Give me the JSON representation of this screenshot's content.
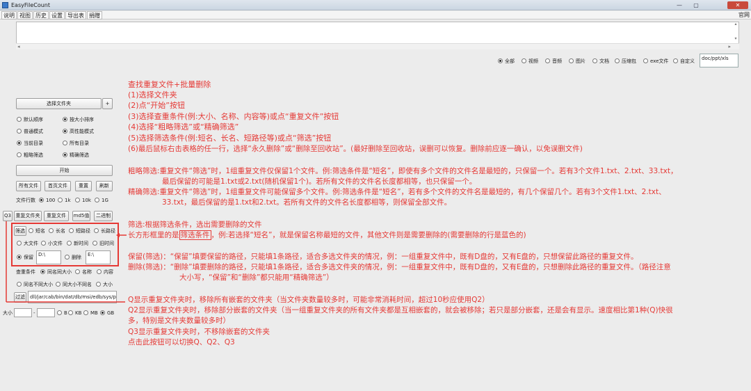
{
  "window": {
    "title": "EasyFileCount",
    "min": "—",
    "max": "▢",
    "close": "✕"
  },
  "menu": {
    "items": [
      "说明",
      "视图",
      "历史",
      "设置",
      "导出表",
      "捐赠"
    ],
    "right": "官网"
  },
  "file_types": {
    "options": [
      "全部",
      "视频",
      "音频",
      "图片",
      "文档",
      "压缩包",
      "exe文件",
      "自定义"
    ],
    "selected": "全部",
    "custom_value": "doc/ppt/xls"
  },
  "left": {
    "select_folder": "选择文件夹",
    "plus": "+",
    "sort_default": "默认顺序",
    "sort_size": "按大小排序",
    "mode_normal": "普通模式",
    "mode_high": "高性能模式",
    "dir_current": "当前目录",
    "dir_all": "所有目录",
    "filter_rough": "粗略筛选",
    "filter_precise": "精确筛选",
    "start": "开始",
    "btn_all_files": "所有文件",
    "btn_first_page": "首页文件",
    "btn_reset": "重置",
    "btn_refresh": "刷新",
    "rows_label": "文件行数",
    "rows_options": [
      "100",
      "1k",
      "10k",
      "1G"
    ],
    "rows_selected": "100",
    "q3": "Q3",
    "dup_folder": "重复文件夹",
    "dup_file": "重复文件",
    "md5": "md5值",
    "binary": "二进制",
    "filter_btn": "筛选",
    "f_short_name": "短名",
    "f_long_name": "长名",
    "f_short_path": "短路径",
    "f_long_path": "长路径",
    "f_big": "大文件",
    "f_small": "小文件",
    "f_new": "新时间",
    "f_old": "旧时间",
    "keep": "保留",
    "keep_value": "D:\\",
    "delete": "删除",
    "delete_value": "E:\\",
    "cond_label": "查重条件",
    "cond_name_size": "同名同大小",
    "cond_name": "名称",
    "cond_content": "内容",
    "cond_diffname": "同名不同大小",
    "cond_diffsize": "同大小不同名",
    "cond_size": "大小",
    "filter_ext_btn": "过滤",
    "filter_ext_value": "dll/jar/cab/bin/dat/db/msi/edb/sys/pak/jsa",
    "size_label": "大小",
    "size_from": "",
    "size_to": "",
    "size_dash": "-",
    "units": [
      "B",
      "KB",
      "MB",
      "GB"
    ],
    "unit_selected": "GB"
  },
  "guide": {
    "steps": [
      "查找重复文件+批量删除",
      "(1)选择文件夹",
      "(2)点“开始”按钮",
      "(3)选择查重条件(例:大小、名称、内容等)或点“重复文件”按钮",
      "(4)选择“粗略筛选”或“精确筛选”",
      "(5)选择筛选条件(例:短名、长名、短路径等)或点“筛选”按钮",
      "(6)最后鼠标右击表格的任一行，选择“永久删除”或“删除至回收站”。(最好删除至回收站，误删可以恢复。删除前应逐一确认，以免误删文件)"
    ],
    "rough": [
      "粗略筛选:重复文件“筛选”时，1组重复文件仅保留1个文件。例:筛选条件是“短名”，即使有多个文件的文件名是最短的，只保留一个。若有3个文件1.txt、2.txt、33.txt，",
      "最后保留的可能是1.txt或2.txt(随机保留1个)。若所有文件的文件名长度都相等，也只保留一个。"
    ],
    "precise": [
      "精确筛选:重复文件“筛选”时，1组重复文件可能保留多个文件。例:筛选条件是“短名”，若有多个文件的文件名是最短的，有几个保留几个。若有3个文件1.txt、2.txt、",
      "33.txt，最后保留的是1.txt和2.txt。若所有文件的文件名长度都相等，则保留全部文件。"
    ],
    "filter_desc": "筛选:根据筛选条件，选出需要删除的文件",
    "box_prefix": "长方形框里的是",
    "box_highlight": "筛选条件",
    "box_suffix": "，例:若选择“短名”，就是保留名称最短的文件，其他文件则是需要删除的(需要删除的行是蓝色的)",
    "keep_desc": "保留(筛选)：“保留”填要保留的路径，只能填1条路径，适合多选文件夹的情况，例：一组重复文件中，既有D盘的，又有E盘的，只想保留此路径的重复文件。",
    "delete_desc": [
      "删除(筛选)：“删除”填要删除的路径，只能填1条路径，适合多选文件夹的情况，例：一组重复文件中，既有D盘的，又有E盘的，只想删除此路径的重复文件。（路径注意",
      "大小写，“保留”和“删除”都只能用“精确筛选”）"
    ],
    "q": [
      "Q显示重复文件夹时，移除所有嵌套的文件夹（当文件夹数量较多时，可能非常消耗时间，超过10秒应使用Q2）",
      "Q2显示重复文件夹时，移除部分嵌套的文件夹（当一组重复文件夹的所有文件夹都是互相嵌套的，就会被移除；若只是部分嵌套，还是会有显示。速度相比第1种(Q)快很",
      "多，特别是文件夹数量较多时）",
      "Q3显示重复文件夹时，不移除嵌套的文件夹",
      "点击此按钮可以切换Q、Q2、Q3"
    ]
  },
  "colors": {
    "annotation": "#e53935"
  }
}
